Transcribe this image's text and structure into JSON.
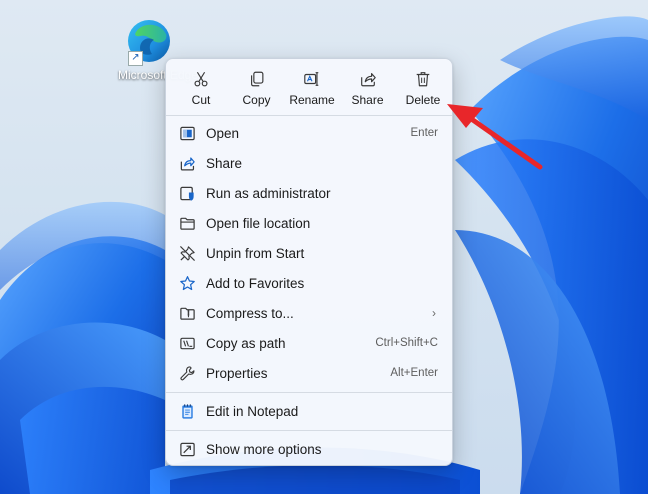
{
  "desktop": {
    "icon_label": "Microsoft Edge",
    "icon_name": "edge-icon"
  },
  "action_bar": [
    {
      "label": "Cut",
      "icon": "scissors-icon"
    },
    {
      "label": "Copy",
      "icon": "copy-icon"
    },
    {
      "label": "Rename",
      "icon": "rename-icon"
    },
    {
      "label": "Share",
      "icon": "share-icon"
    },
    {
      "label": "Delete",
      "icon": "trash-icon"
    }
  ],
  "menu_items": [
    {
      "label": "Open",
      "shortcut": "Enter",
      "icon": "open-icon"
    },
    {
      "label": "Share",
      "shortcut": "",
      "icon": "share-icon"
    },
    {
      "label": "Run as administrator",
      "shortcut": "",
      "icon": "admin-shield-icon"
    },
    {
      "label": "Open file location",
      "shortcut": "",
      "icon": "folder-icon"
    },
    {
      "label": "Unpin from Start",
      "shortcut": "",
      "icon": "unpin-icon"
    },
    {
      "label": "Add to Favorites",
      "shortcut": "",
      "icon": "star-icon"
    },
    {
      "label": "Compress to...",
      "shortcut": "",
      "icon": "zip-folder-icon",
      "submenu": true
    },
    {
      "label": "Copy as path",
      "shortcut": "Ctrl+Shift+C",
      "icon": "copy-path-icon"
    },
    {
      "label": "Properties",
      "shortcut": "Alt+Enter",
      "icon": "wrench-icon"
    },
    {
      "label": "Edit in Notepad",
      "shortcut": "",
      "icon": "notepad-icon"
    },
    {
      "label": "Show more options",
      "shortcut": "",
      "icon": "more-options-icon"
    }
  ],
  "colors": {
    "accent": "#0067c0",
    "annotation": "#e8262a",
    "wallpaper_blue": "#1565e6"
  }
}
